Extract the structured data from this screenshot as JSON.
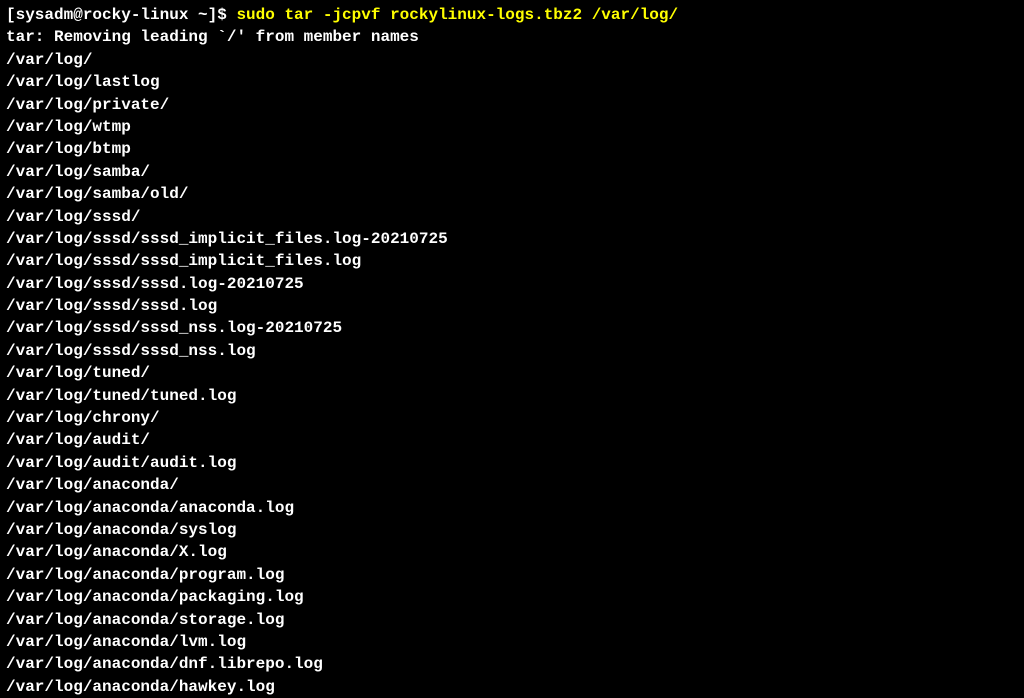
{
  "prompt": "[sysadm@rocky-linux ~]$ ",
  "command": "sudo tar -jcpvf rockylinux-logs.tbz2 /var/log/",
  "output_lines": [
    "tar: Removing leading `/' from member names",
    "/var/log/",
    "/var/log/lastlog",
    "/var/log/private/",
    "/var/log/wtmp",
    "/var/log/btmp",
    "/var/log/samba/",
    "/var/log/samba/old/",
    "/var/log/sssd/",
    "/var/log/sssd/sssd_implicit_files.log-20210725",
    "/var/log/sssd/sssd_implicit_files.log",
    "/var/log/sssd/sssd.log-20210725",
    "/var/log/sssd/sssd.log",
    "/var/log/sssd/sssd_nss.log-20210725",
    "/var/log/sssd/sssd_nss.log",
    "/var/log/tuned/",
    "/var/log/tuned/tuned.log",
    "/var/log/chrony/",
    "/var/log/audit/",
    "/var/log/audit/audit.log",
    "/var/log/anaconda/",
    "/var/log/anaconda/anaconda.log",
    "/var/log/anaconda/syslog",
    "/var/log/anaconda/X.log",
    "/var/log/anaconda/program.log",
    "/var/log/anaconda/packaging.log",
    "/var/log/anaconda/storage.log",
    "/var/log/anaconda/lvm.log",
    "/var/log/anaconda/dnf.librepo.log",
    "/var/log/anaconda/hawkey.log"
  ]
}
